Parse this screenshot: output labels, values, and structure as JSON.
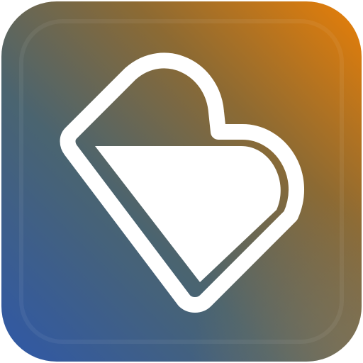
{
  "app_icon": {
    "icon": "heart-diamond-logo-icon",
    "colors": {
      "gradient_orange": "#e97f07",
      "gradient_olive": "#8c6a33",
      "gradient_teal": "#4a6470",
      "gradient_blue": "#2f58a8",
      "glyph": "#ffffff"
    }
  }
}
